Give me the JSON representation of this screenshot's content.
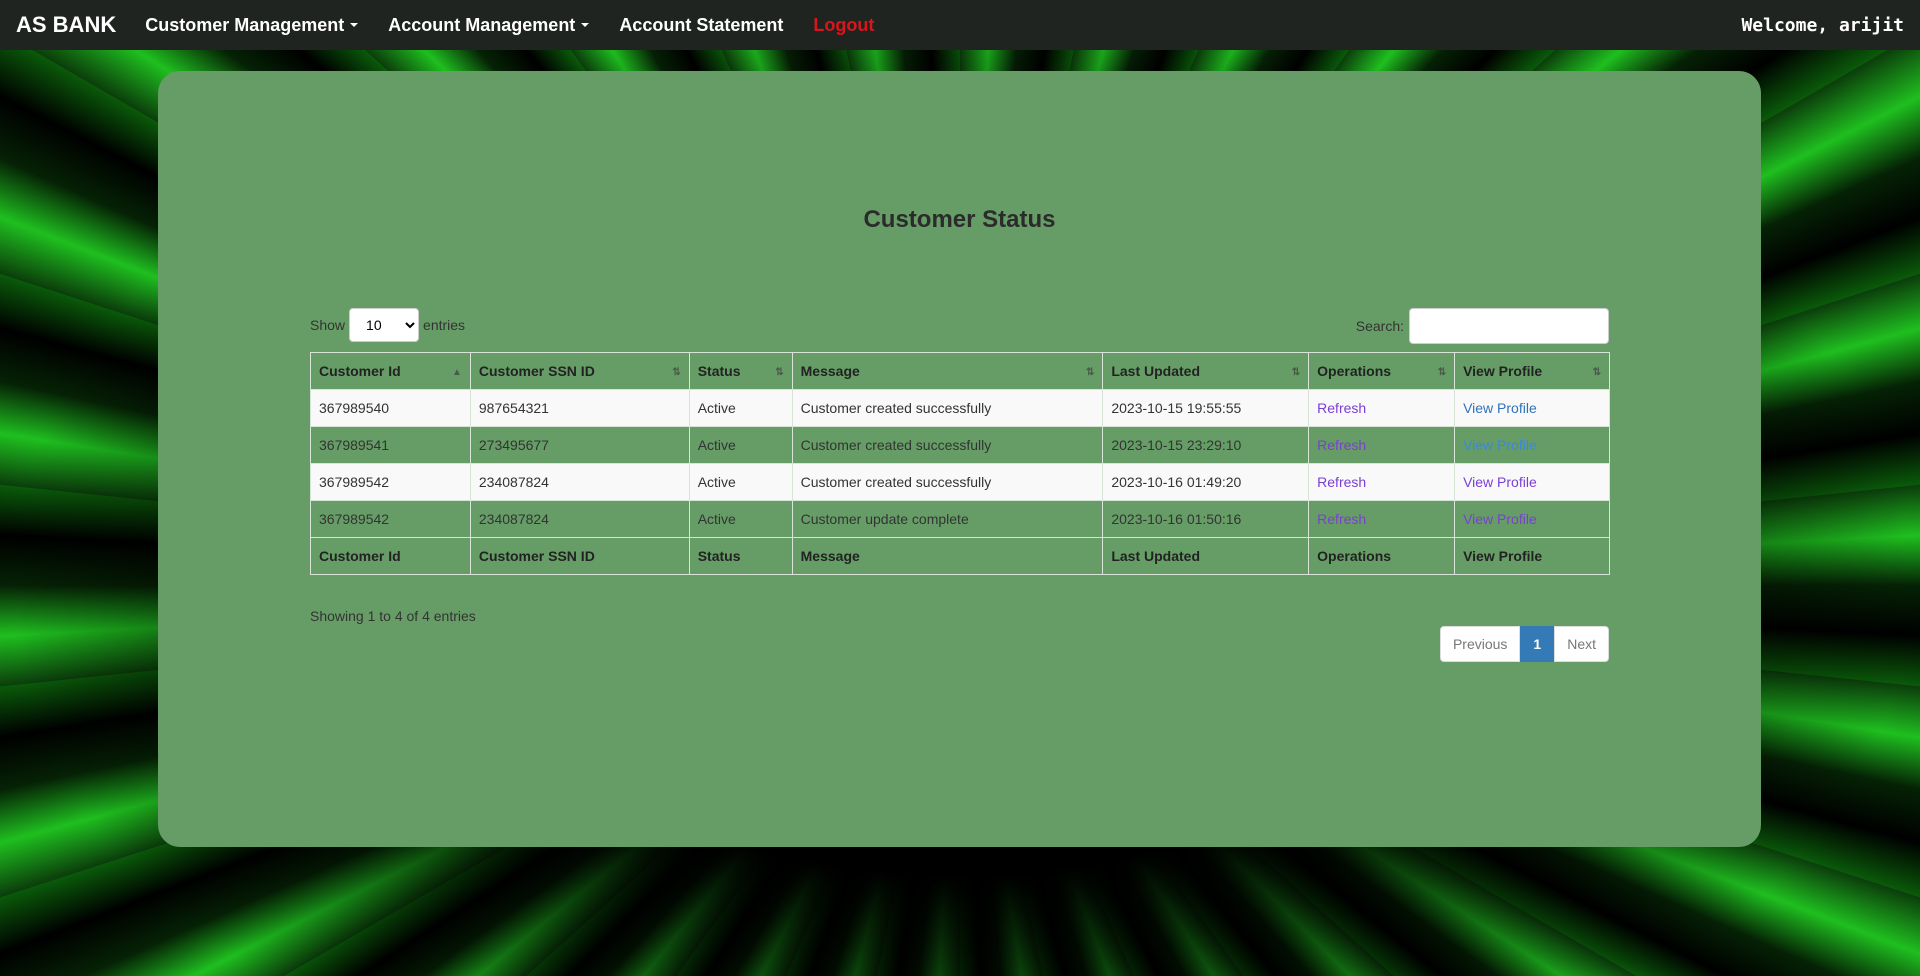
{
  "nav": {
    "brand": "AS BANK",
    "items": [
      {
        "label": "Customer Management",
        "dropdown": true
      },
      {
        "label": "Account Management",
        "dropdown": true
      },
      {
        "label": "Account Statement",
        "dropdown": false
      }
    ],
    "logout": "Logout",
    "welcome": "Welcome, arijit"
  },
  "page": {
    "title": "Customer Status"
  },
  "table_controls": {
    "show_label": "Show",
    "length_value": "10",
    "entries_label": "entries",
    "search_label": "Search:",
    "search_value": ""
  },
  "table": {
    "columns": [
      "Customer Id",
      "Customer SSN ID",
      "Status",
      "Message",
      "Last Updated",
      "Operations",
      "View Profile"
    ],
    "rows": [
      {
        "customer_id": "367989540",
        "ssn_id": "987654321",
        "status": "Active",
        "message": "Customer created successfully",
        "last_updated": "2023-10-15 19:55:55",
        "operation": "Refresh",
        "profile": "View Profile"
      },
      {
        "customer_id": "367989541",
        "ssn_id": "273495677",
        "status": "Active",
        "message": "Customer created successfully",
        "last_updated": "2023-10-15 23:29:10",
        "operation": "Refresh",
        "profile": "View Profile"
      },
      {
        "customer_id": "367989542",
        "ssn_id": "234087824",
        "status": "Active",
        "message": "Customer created successfully",
        "last_updated": "2023-10-16 01:49:20",
        "operation": "Refresh",
        "profile": "View Profile"
      },
      {
        "customer_id": "367989542",
        "ssn_id": "234087824",
        "status": "Active",
        "message": "Customer update complete",
        "last_updated": "2023-10-16 01:50:16",
        "operation": "Refresh",
        "profile": "View Profile"
      }
    ],
    "sort_icons": [
      "sort-asc-icon",
      "sort-icon",
      "sort-icon",
      "sort-icon",
      "sort-icon",
      "sort-icon",
      "sort-icon"
    ]
  },
  "info": "Showing 1 to 4 of 4 entries",
  "pagination": {
    "previous": "Previous",
    "current": "1",
    "next": "Next"
  },
  "colors": {
    "navbar": "#1f2420",
    "panel": "#669d66",
    "logout": "#d8161b",
    "refresh_link": "#7b3fd4",
    "profile_link": "#2f73b8",
    "active_page": "#337ab7"
  }
}
